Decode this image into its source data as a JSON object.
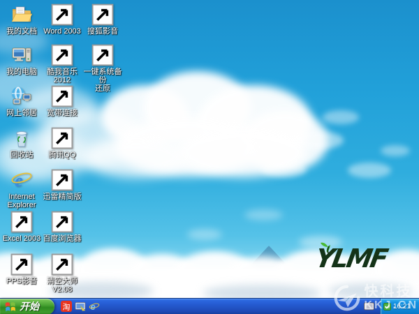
{
  "desktop": {
    "icons": [
      {
        "id": "my-documents",
        "label": "我的文档",
        "col": 0,
        "row": 0,
        "shortcut": false
      },
      {
        "id": "my-computer",
        "label": "我的电脑",
        "col": 0,
        "row": 1,
        "shortcut": false
      },
      {
        "id": "network-places",
        "label": "网上邻居",
        "col": 0,
        "row": 2,
        "shortcut": false
      },
      {
        "id": "recycle-bin",
        "label": "回收站",
        "col": 0,
        "row": 3,
        "shortcut": false
      },
      {
        "id": "internet-explorer",
        "label": "Internet\nExplorer",
        "col": 0,
        "row": 4,
        "shortcut": false
      },
      {
        "id": "excel-2003",
        "label": "Excel 2003",
        "col": 0,
        "row": 5,
        "shortcut": true
      },
      {
        "id": "pps-video",
        "label": "PPS影音",
        "col": 0,
        "row": 6,
        "shortcut": true
      },
      {
        "id": "word-2003",
        "label": "Word 2003",
        "col": 1,
        "row": 0,
        "shortcut": true
      },
      {
        "id": "kuwo-music",
        "label": "酷我音乐\n2012",
        "col": 1,
        "row": 1,
        "shortcut": true
      },
      {
        "id": "broadband-connection",
        "label": "宽带连接",
        "col": 1,
        "row": 2,
        "shortcut": true
      },
      {
        "id": "tencent-qq",
        "label": "腾讯QQ",
        "col": 1,
        "row": 3,
        "shortcut": true
      },
      {
        "id": "xunlei-lite",
        "label": "迅雷精简版",
        "col": 1,
        "row": 4,
        "shortcut": true
      },
      {
        "id": "baidu-browser",
        "label": "百度浏览器",
        "col": 1,
        "row": 5,
        "shortcut": true
      },
      {
        "id": "qingkong-master",
        "label": "清空大师\nV2.08",
        "col": 1,
        "row": 6,
        "shortcut": true
      },
      {
        "id": "sohu-video",
        "label": "搜狐影音",
        "col": 2,
        "row": 0,
        "shortcut": true
      },
      {
        "id": "onekey-backup",
        "label": "一键系统备份\n还原",
        "col": 2,
        "row": 1,
        "shortcut": true
      }
    ]
  },
  "taskbar": {
    "start_label": "开始",
    "quick_launch": [
      {
        "id": "taobao",
        "name": "淘宝",
        "glyph": "淘"
      },
      {
        "id": "show-desktop",
        "name": "显示桌面"
      },
      {
        "id": "ie-quicklaunch",
        "name": "Internet Explorer"
      }
    ],
    "tray_time": "16:21"
  },
  "watermarks": {
    "ylmf_logo": "YLMF",
    "kkj_title": "快科技",
    "kkj_domain": "KKJ.CN"
  },
  "colors": {
    "sky_top": "#1b90cd",
    "sky_bottom": "#c2eaf6",
    "taskbar_blue": "#2458cd",
    "start_green": "#3f9c2d",
    "tray_blue": "#0e82d2",
    "ylmf_green": "#143318",
    "taobao_red": "#e6331f"
  }
}
